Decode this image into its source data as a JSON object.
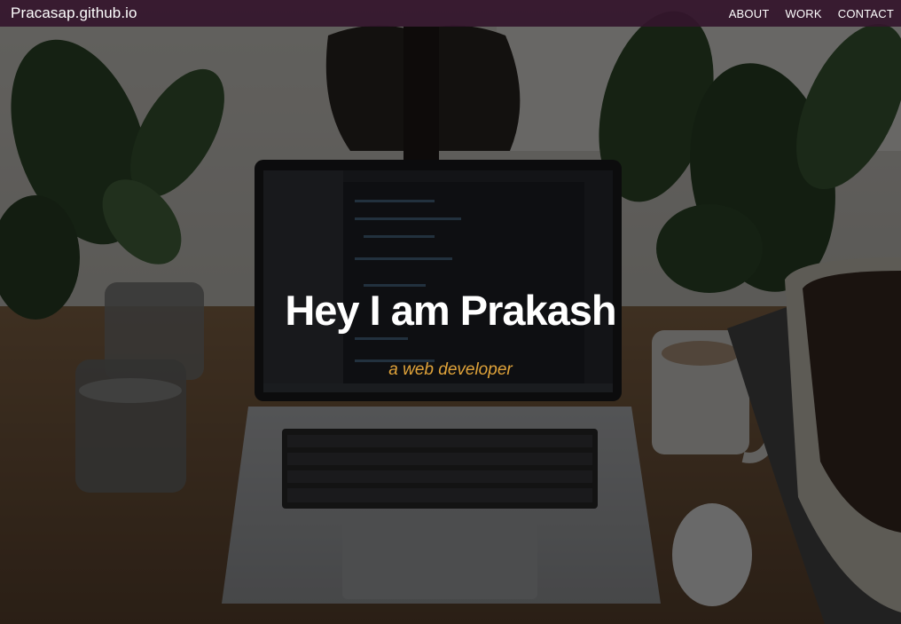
{
  "navbar": {
    "brand": "Pracasap.github.io",
    "links": [
      {
        "label": "ABOUT"
      },
      {
        "label": "WORK"
      },
      {
        "label": "CONTACT"
      }
    ]
  },
  "hero": {
    "title": "Hey I am Prakash",
    "subtitle": "a web developer"
  },
  "colors": {
    "navbar_bg": "#34162c",
    "title": "#ffffff",
    "subtitle_accent": "#e0a33a"
  }
}
